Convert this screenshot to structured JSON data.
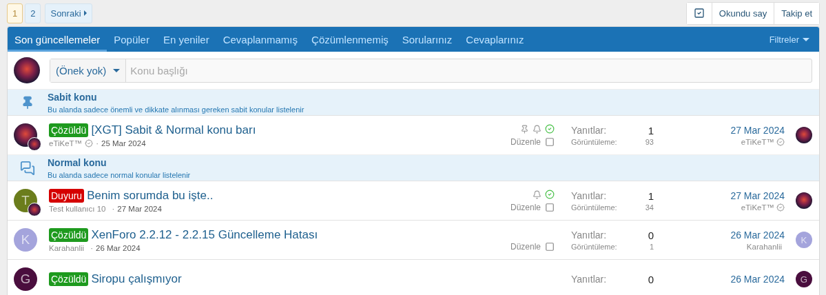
{
  "pagination": {
    "pages": [
      {
        "label": "1",
        "selected": true
      },
      {
        "label": "2",
        "selected": false
      }
    ],
    "next": "Sonraki"
  },
  "actions": {
    "mark_read": "Okundu say",
    "follow": "Takip et"
  },
  "tabs": [
    {
      "label": "Son güncellemeler",
      "selected": true
    },
    {
      "label": "Popüler",
      "selected": false
    },
    {
      "label": "En yeniler",
      "selected": false
    },
    {
      "label": "Cevaplanmamış",
      "selected": false
    },
    {
      "label": "Çözümlenmemiş",
      "selected": false
    },
    {
      "label": "Sorularınız",
      "selected": false
    },
    {
      "label": "Cevaplarınız",
      "selected": false
    }
  ],
  "filters": "Filtreler",
  "new_thread": {
    "prefix": "(Önek yok)",
    "placeholder": "Konu başlığı"
  },
  "groups": [
    {
      "kind": "sticky",
      "title": "Sabit konu",
      "description": "Bu alanda sadece önemli ve dikkate alınması gereken sabit konular listelenir",
      "threads": [
        {
          "avatar": {
            "kind": "logo"
          },
          "badge_avatar": true,
          "prefix": {
            "label": "Çözüldü",
            "color": "#1e9a1e"
          },
          "title": "[XGT] Sabit & Normal konu barı",
          "author": "eTiKeT™",
          "verified": true,
          "separator": "·",
          "date": "25 Mar 2024",
          "pinned": true,
          "watched": true,
          "solved": true,
          "edit": "Düzenle",
          "checked": false,
          "replies_label": "Yanıtlar:",
          "replies": "1",
          "views_label": "Görüntüleme:",
          "views": "93",
          "last_date": "27 Mar 2024",
          "last_author": "eTiKeT™",
          "last_verified": true,
          "last_avatar": {
            "kind": "logo"
          }
        }
      ]
    },
    {
      "kind": "normal",
      "title": "Normal konu",
      "description": "Bu alanda sadece normal konular listelenir",
      "threads": [
        {
          "avatar": {
            "kind": "letter",
            "letter": "T",
            "color": "#6b7d1c"
          },
          "badge_avatar": true,
          "prefix": {
            "label": "Duyuru",
            "color": "#d50000"
          },
          "title": "Benim sorumda bu işte..",
          "author": "Test kullanıcı 10",
          "verified": false,
          "separator": "·",
          "date": "27 Mar 2024",
          "pinned": false,
          "watched": true,
          "solved": true,
          "edit": "Düzenle",
          "checked": false,
          "replies_label": "Yanıtlar:",
          "replies": "1",
          "views_label": "Görüntüleme:",
          "views": "34",
          "last_date": "27 Mar 2024",
          "last_author": "eTiKeT™",
          "last_verified": true,
          "last_avatar": {
            "kind": "logo"
          }
        },
        {
          "avatar": {
            "kind": "letter",
            "letter": "K",
            "color": "#a4a4dc"
          },
          "badge_avatar": false,
          "prefix": {
            "label": "Çözüldü",
            "color": "#1e9a1e"
          },
          "title": "XenForo 2.2.12 - 2.2.15 Güncelleme Hatası",
          "author": "Karahanlii",
          "verified": false,
          "separator": "·",
          "date": "26 Mar 2024",
          "pinned": false,
          "watched": false,
          "solved": false,
          "edit": "Düzenle",
          "checked": false,
          "replies_label": "Yanıtlar:",
          "replies": "0",
          "views_label": "Görüntüleme:",
          "views": "1",
          "last_date": "26 Mar 2024",
          "last_author": "Karahanlii",
          "last_verified": false,
          "last_avatar": {
            "kind": "letter",
            "letter": "K",
            "color": "#a4a4dc"
          }
        },
        {
          "avatar": {
            "kind": "letter",
            "letter": "G",
            "color": "#4a0e3e"
          },
          "badge_avatar": false,
          "prefix": {
            "label": "Çözüldü",
            "color": "#1e9a1e"
          },
          "title": "Siropu çalışmıyor",
          "pinned": false,
          "watched": false,
          "solved": false,
          "replies_label": "Yanıtlar:",
          "replies": "0",
          "last_date": "26 Mar 2024",
          "last_avatar": {
            "kind": "letter",
            "letter": "G",
            "color": "#4a0e3e"
          }
        }
      ]
    }
  ]
}
